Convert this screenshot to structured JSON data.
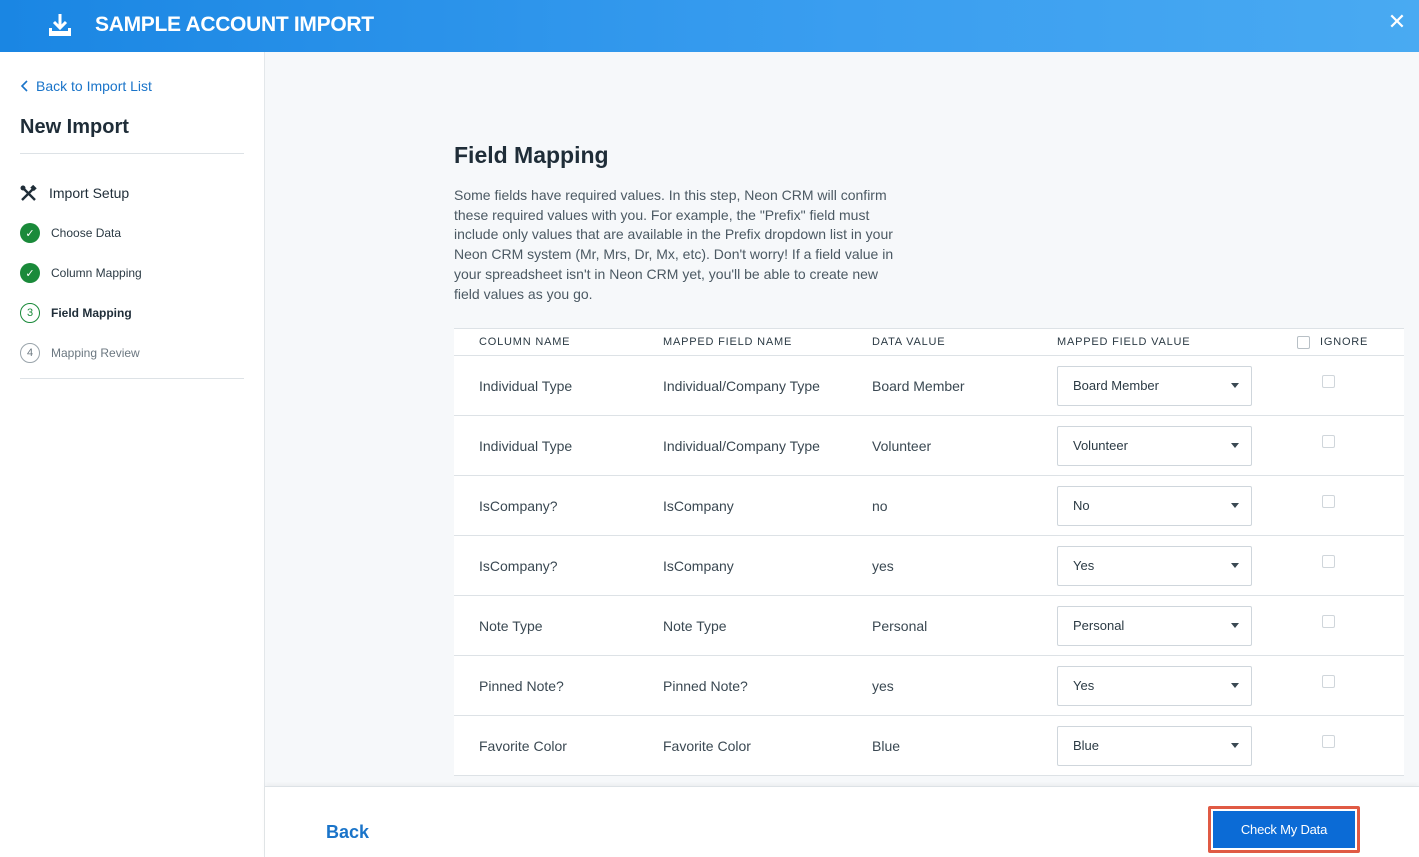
{
  "header": {
    "title": "SAMPLE ACCOUNT IMPORT",
    "close_glyph": "✕"
  },
  "sidebar": {
    "back_label": "Back to Import List",
    "heading": "New Import",
    "section_label": "Import Setup",
    "steps": [
      {
        "label": "Choose Data",
        "status": "done",
        "badge": "✓"
      },
      {
        "label": "Column Mapping",
        "status": "done",
        "badge": "✓"
      },
      {
        "label": "Field Mapping",
        "status": "current",
        "badge": "3"
      },
      {
        "label": "Mapping Review",
        "status": "todo",
        "badge": "4"
      }
    ]
  },
  "main": {
    "title": "Field Mapping",
    "description": "Some fields have required values. In this step, Neon CRM will confirm these required values with you. For example, the \"Prefix\" field must include only values that are available in the Prefix dropdown list in your Neon CRM system (Mr, Mrs, Dr, Mx, etc). Don't worry! If a field value in your spreadsheet isn't in Neon CRM yet, you'll be able to create new field values as you go.",
    "table": {
      "headers": [
        "COLUMN NAME",
        "MAPPED FIELD NAME",
        "DATA VALUE",
        "MAPPED FIELD VALUE",
        "IGNORE"
      ],
      "rows": [
        {
          "column": "Individual Type",
          "field": "Individual/Company Type",
          "data": "Board Member",
          "mapped": "Board Member"
        },
        {
          "column": "Individual Type",
          "field": "Individual/Company Type",
          "data": "Volunteer",
          "mapped": "Volunteer"
        },
        {
          "column": "IsCompany?",
          "field": "IsCompany",
          "data": "no",
          "mapped": "No"
        },
        {
          "column": "IsCompany?",
          "field": "IsCompany",
          "data": "yes",
          "mapped": "Yes"
        },
        {
          "column": "Note Type",
          "field": "Note Type",
          "data": "Personal",
          "mapped": "Personal"
        },
        {
          "column": "Pinned Note?",
          "field": "Pinned Note?",
          "data": "yes",
          "mapped": "Yes"
        },
        {
          "column": "Favorite Color",
          "field": "Favorite Color",
          "data": "Blue",
          "mapped": "Blue"
        }
      ]
    }
  },
  "footer": {
    "back_label": "Back",
    "check_label": "Check My Data"
  },
  "colors": {
    "header_start": "#1a86e3",
    "header_end": "#49aaf2",
    "accent_blue": "#0b6bd6",
    "success_green": "#1a8a3a",
    "highlight_red": "#e05a44"
  }
}
